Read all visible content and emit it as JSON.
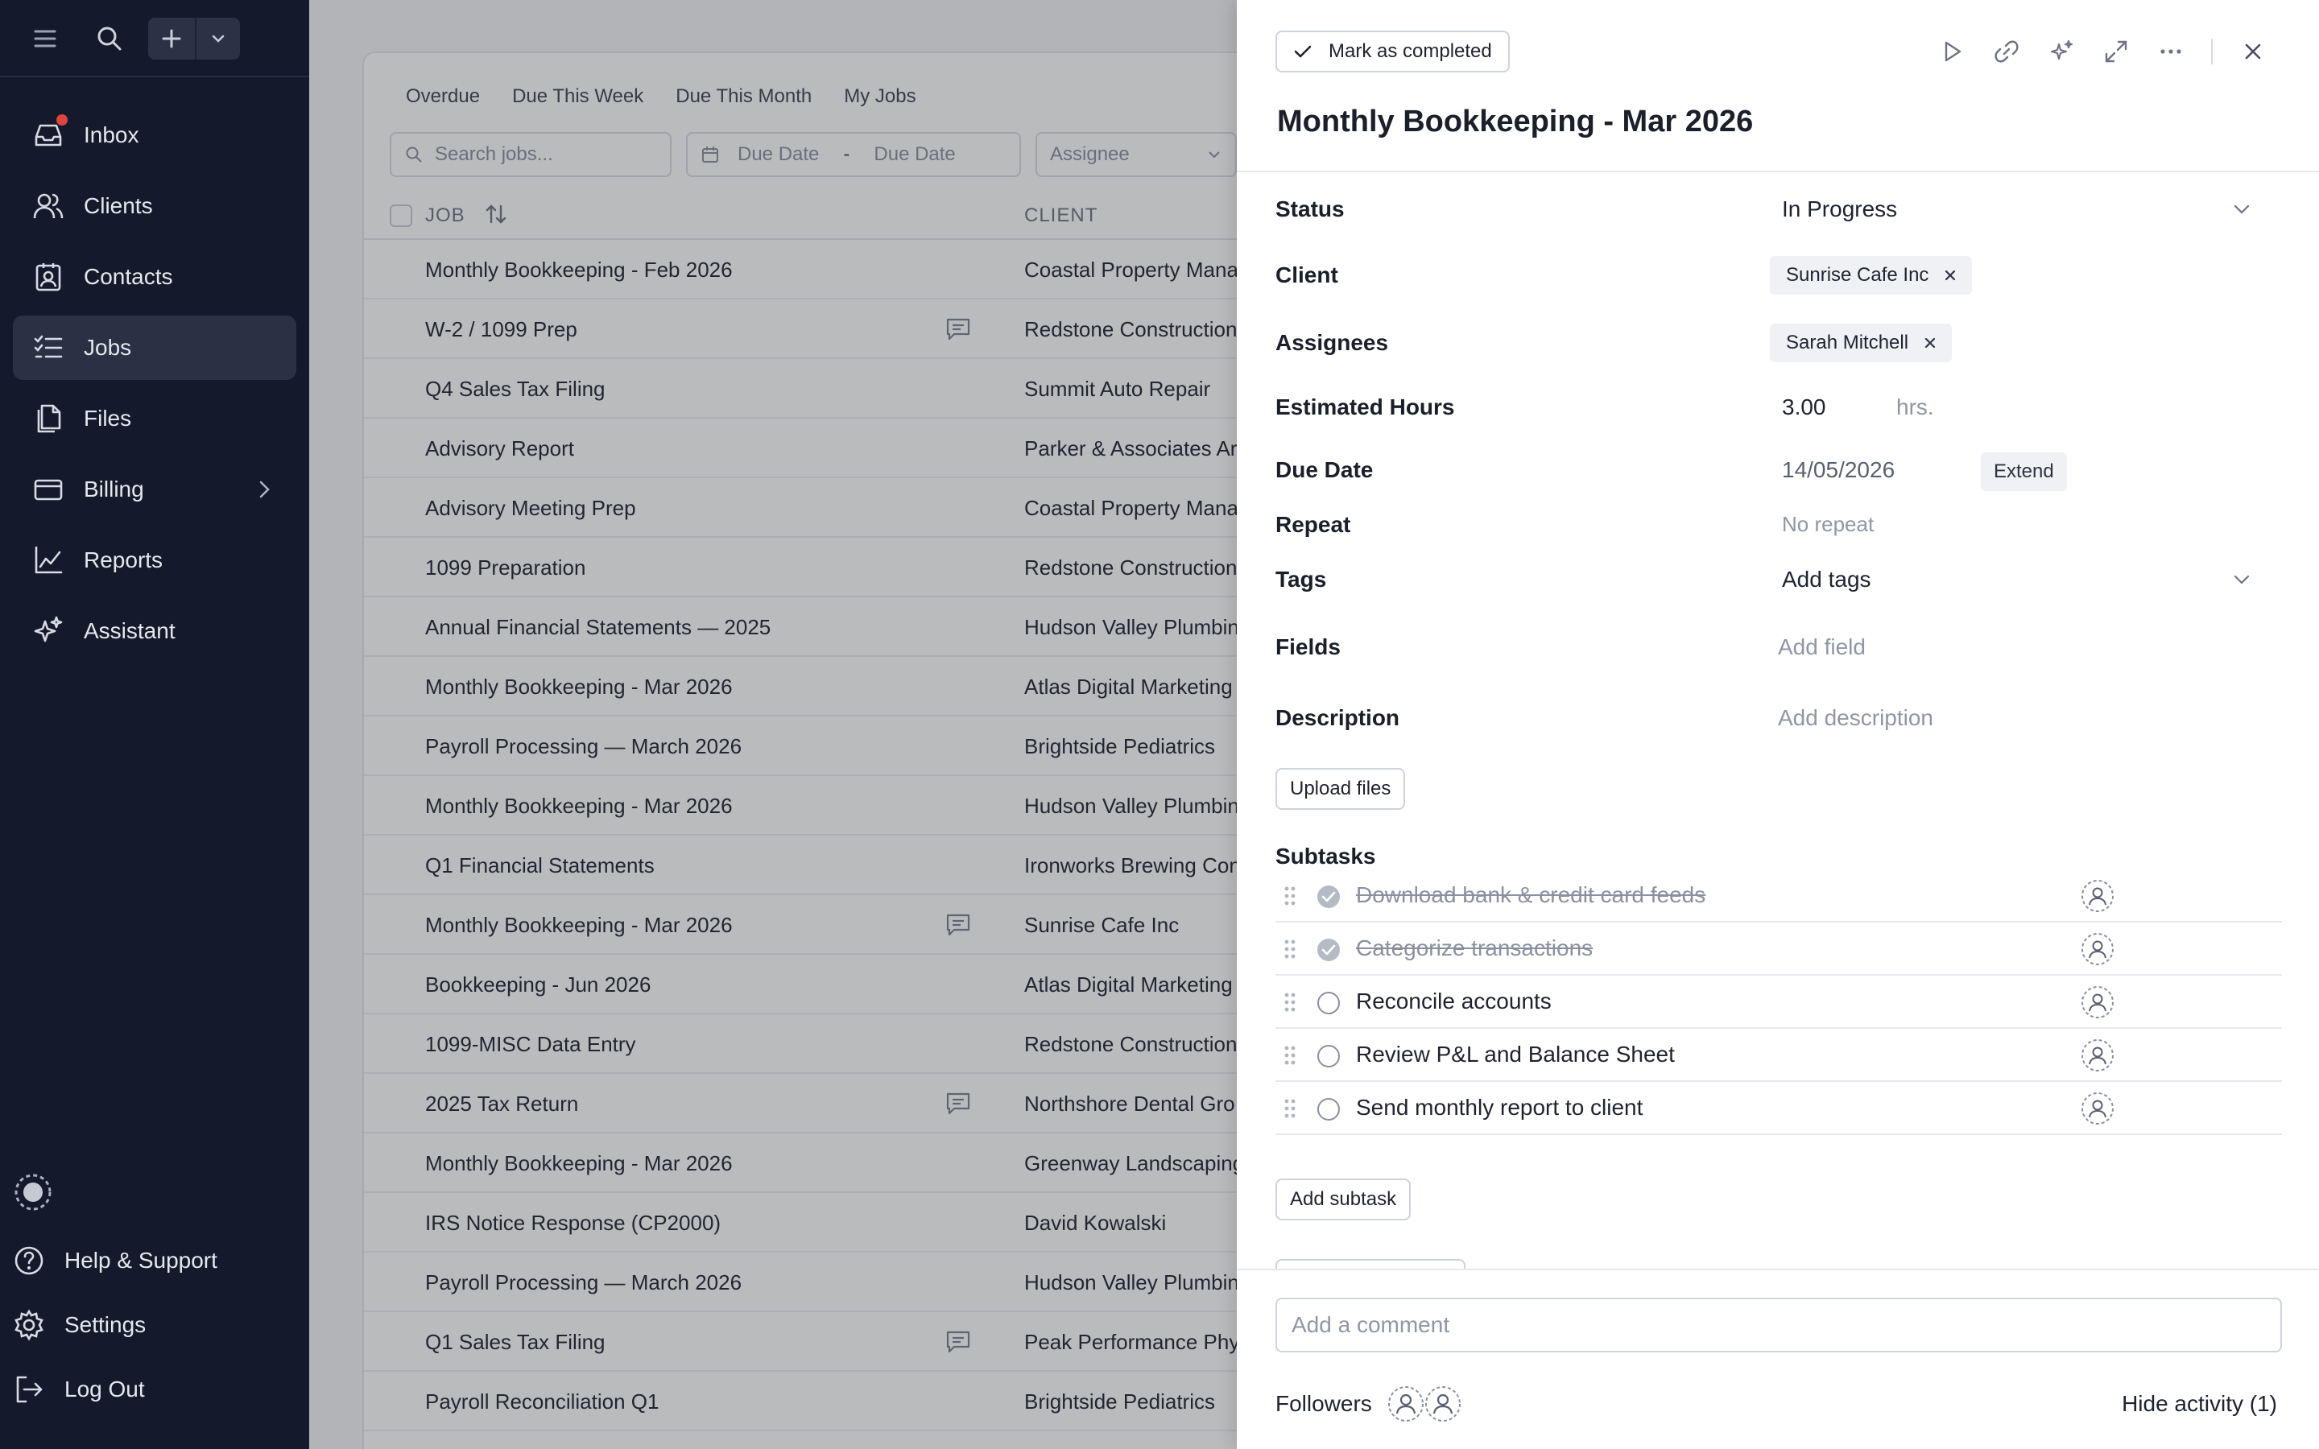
{
  "sidebar": {
    "nav": [
      {
        "label": "Inbox",
        "icon": "inbox-icon",
        "has_notification": true
      },
      {
        "label": "Clients",
        "icon": "users-icon"
      },
      {
        "label": "Contacts",
        "icon": "contact-card-icon"
      },
      {
        "label": "Jobs",
        "icon": "checklist-icon",
        "active": true
      },
      {
        "label": "Files",
        "icon": "files-icon"
      },
      {
        "label": "Billing",
        "icon": "credit-card-icon",
        "has_submenu": true
      },
      {
        "label": "Reports",
        "icon": "line-chart-icon"
      },
      {
        "label": "Assistant",
        "icon": "sparkle-icon"
      }
    ],
    "bottom": [
      {
        "label": "Help & Support",
        "icon": "help-circle-icon"
      },
      {
        "label": "Settings",
        "icon": "gear-icon"
      },
      {
        "label": "Log Out",
        "icon": "logout-icon"
      }
    ]
  },
  "jobs_list": {
    "tabs": [
      "Overdue",
      "Due This Week",
      "Due This Month",
      "My Jobs"
    ],
    "search_placeholder": "Search jobs...",
    "due_date_from": "Due Date",
    "due_date_sep": "-",
    "due_date_to": "Due Date",
    "assignee_placeholder": "Assignee",
    "columns": {
      "job": "JOB",
      "client": "CLIENT"
    },
    "rows": [
      {
        "job": "Monthly Bookkeeping - Feb 2026",
        "client": "Coastal Property Mana",
        "comment": false
      },
      {
        "job": "W-2 / 1099 Prep",
        "client": "Redstone Construction",
        "comment": true
      },
      {
        "job": "Q4 Sales Tax Filing",
        "client": "Summit Auto Repair",
        "comment": false
      },
      {
        "job": "Advisory Report",
        "client": "Parker & Associates Arc",
        "comment": false
      },
      {
        "job": "Advisory Meeting Prep",
        "client": "Coastal Property Mana",
        "comment": false
      },
      {
        "job": "1099 Preparation",
        "client": "Redstone Construction",
        "comment": false
      },
      {
        "job": "Annual Financial Statements — 2025",
        "client": "Hudson Valley Plumbin",
        "comment": false
      },
      {
        "job": "Monthly Bookkeeping - Mar 2026",
        "client": "Atlas Digital Marketing",
        "comment": false
      },
      {
        "job": "Payroll Processing — March 2026",
        "client": "Brightside Pediatrics",
        "comment": false
      },
      {
        "job": "Monthly Bookkeeping - Mar 2026",
        "client": "Hudson Valley Plumbin",
        "comment": false
      },
      {
        "job": "Q1 Financial Statements",
        "client": "Ironworks Brewing Con",
        "comment": false
      },
      {
        "job": "Monthly Bookkeeping - Mar 2026",
        "client": "Sunrise Cafe Inc",
        "comment": true
      },
      {
        "job": "Bookkeeping - Jun 2026",
        "client": "Atlas Digital Marketing",
        "comment": false
      },
      {
        "job": "1099-MISC Data Entry",
        "client": "Redstone Construction",
        "comment": false
      },
      {
        "job": "2025 Tax Return",
        "client": "Northshore Dental Gro",
        "comment": true
      },
      {
        "job": "Monthly Bookkeeping - Mar 2026",
        "client": "Greenway Landscaping",
        "comment": false
      },
      {
        "job": "IRS Notice Response (CP2000)",
        "client": "David Kowalski",
        "comment": false
      },
      {
        "job": "Payroll Processing — March 2026",
        "client": "Hudson Valley Plumbin",
        "comment": false
      },
      {
        "job": "Q1 Sales Tax Filing",
        "client": "Peak Performance Phys",
        "comment": true
      },
      {
        "job": "Payroll Reconciliation Q1",
        "client": "Brightside Pediatrics",
        "comment": false
      }
    ]
  },
  "detail": {
    "mark_completed": "Mark as completed",
    "title": "Monthly Bookkeeping - Mar 2026",
    "fields": {
      "status_label": "Status",
      "status_value": "In Progress",
      "client_label": "Client",
      "client_value": "Sunrise Cafe Inc",
      "assignees_label": "Assignees",
      "assignee_value": "Sarah Mitchell",
      "hours_label": "Estimated Hours",
      "hours_value": "3.00",
      "hours_unit": "hrs.",
      "due_label": "Due Date",
      "due_value": "14/05/2026",
      "extend": "Extend",
      "repeat_label": "Repeat",
      "repeat_value": "No repeat",
      "tags_label": "Tags",
      "tags_value": "Add tags",
      "fields_label": "Fields",
      "fields_value": "Add field",
      "description_label": "Description",
      "description_value": "Add description"
    },
    "upload_files": "Upload files",
    "subtasks_label": "Subtasks",
    "subtasks": [
      {
        "text": "Download bank & credit card feeds",
        "done": true
      },
      {
        "text": "Categorize transactions",
        "done": true
      },
      {
        "text": "Reconcile accounts",
        "done": false
      },
      {
        "text": "Review P&L and Balance Sheet",
        "done": false
      },
      {
        "text": "Send monthly report to client",
        "done": false
      }
    ],
    "add_subtask": "Add subtask",
    "comment_placeholder": "Add a comment",
    "followers_label": "Followers",
    "hide_activity": "Hide activity (1)"
  },
  "colors": {
    "sidebar_bg": "#141a2b",
    "sidebar_active": "#2a3144",
    "notification": "#e0453b",
    "done_check": "#b6bac5"
  }
}
